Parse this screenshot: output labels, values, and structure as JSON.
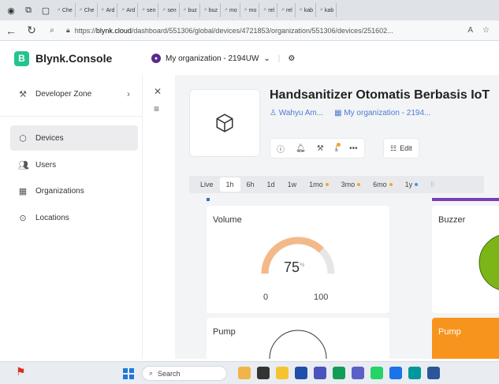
{
  "browser": {
    "tabs": [
      "Che",
      "Che",
      "Ard",
      "Ard",
      "sen",
      "sen",
      "buz",
      "buz",
      "mo",
      "mo",
      "rel",
      "rel",
      "kab",
      "kab"
    ],
    "url_prefix": "https://",
    "url_host": "blynk.cloud",
    "url_path": "/dashboard/551306/global/devices/4721853/organization/551306/devices/251602..."
  },
  "app": {
    "brand_letter": "B",
    "brand_name": "Blynk.Console",
    "org_name": "My organization - 2194UW"
  },
  "sidebar": {
    "items": [
      {
        "label": "Developer Zone",
        "icon": "tools-icon"
      },
      {
        "label": "Devices",
        "icon": "cube-icon"
      },
      {
        "label": "Users",
        "icon": "users-icon"
      },
      {
        "label": "Organizations",
        "icon": "building-icon"
      },
      {
        "label": "Locations",
        "icon": "location-pin-icon"
      }
    ]
  },
  "device": {
    "title": "Handsanitizer Otomatis Berbasis IoT",
    "owner": "Wahyu Am...",
    "org": "My organization - 2194...",
    "edit_label": "Edit"
  },
  "time_ranges": [
    {
      "label": "Live"
    },
    {
      "label": "1h",
      "selected": true
    },
    {
      "label": "6h"
    },
    {
      "label": "1d"
    },
    {
      "label": "1w"
    },
    {
      "label": "1mo",
      "dot": "#f5a623"
    },
    {
      "label": "3mo",
      "dot": "#f5a623"
    },
    {
      "label": "6mo",
      "dot": "#f5a623"
    },
    {
      "label": "1y",
      "dot": "#4a90e2"
    }
  ],
  "widgets": {
    "volume": {
      "title": "Volume",
      "value": "75",
      "unit": "%",
      "min": "0",
      "max": "100",
      "level": 0.75
    },
    "buzzer": {
      "title": "Buzzer"
    },
    "pump_gauge": {
      "title": "Pump"
    },
    "pump_orange": {
      "title": "Pump"
    }
  },
  "taskbar": {
    "search_placeholder": "Search"
  },
  "colors": {
    "brand": "#23c48e",
    "gauge_fill": "#f4b98a",
    "gauge_track": "#e6e6e6",
    "pump_orange": "#f7941d",
    "buzzer_green": "#7cb518"
  }
}
